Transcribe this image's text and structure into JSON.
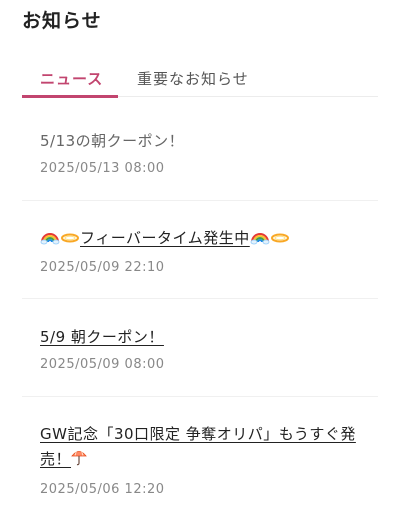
{
  "header": {
    "title": "お知らせ"
  },
  "tabs": [
    {
      "label": "ニュース",
      "active": true
    },
    {
      "label": "重要なお知らせ",
      "active": false
    }
  ],
  "colors": {
    "accent": "#c2456f"
  },
  "news": [
    {
      "title": "5/13の朝クーポン！",
      "date": "2025/05/13 08:00",
      "read": true
    },
    {
      "title": "フィーバータイム発生中",
      "date": "2025/05/09 22:10",
      "read": false
    },
    {
      "title": "5/9 朝クーポン！",
      "date": "2025/05/09 08:00",
      "read": false
    },
    {
      "title": "GW記念「30口限定 争奪オリパ」もうすぐ発売！",
      "date": "2025/05/06 12:20",
      "read": false
    }
  ]
}
